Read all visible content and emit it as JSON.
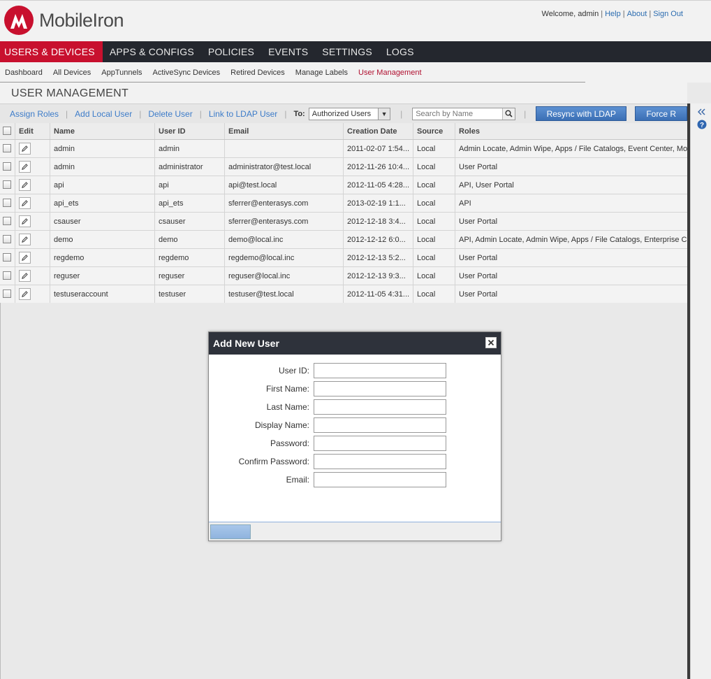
{
  "brand": {
    "name": "MobileIron",
    "accent": "#c8102e"
  },
  "top_links": {
    "welcome": "Welcome, admin",
    "help": "Help",
    "about": "About",
    "sign_out": "Sign Out"
  },
  "main_nav": [
    {
      "label": "USERS & DEVICES",
      "active": true
    },
    {
      "label": "APPS & CONFIGS"
    },
    {
      "label": "POLICIES"
    },
    {
      "label": "EVENTS"
    },
    {
      "label": "SETTINGS"
    },
    {
      "label": "LOGS"
    }
  ],
  "sub_nav": [
    {
      "label": "Dashboard"
    },
    {
      "label": "All Devices"
    },
    {
      "label": "AppTunnels"
    },
    {
      "label": "ActiveSync Devices"
    },
    {
      "label": "Retired Devices"
    },
    {
      "label": "Manage Labels"
    },
    {
      "label": "User Management",
      "active": true
    }
  ],
  "page_title": "USER MANAGEMENT",
  "toolbar": {
    "assign_roles": "Assign Roles",
    "add_local_user": "Add Local User",
    "delete_user": "Delete User",
    "link_ldap": "Link to LDAP User",
    "to_label": "To:",
    "to_select": "Authorized Users",
    "search_placeholder": "Search by Name",
    "resync": "Resync with LDAP",
    "force": "Force R"
  },
  "table": {
    "headers": {
      "edit": "Edit",
      "name": "Name",
      "user_id": "User ID",
      "email": "Email",
      "creation_date": "Creation Date",
      "source": "Source",
      "roles": "Roles"
    },
    "rows": [
      {
        "name": "admin",
        "user_id": "admin",
        "email": "",
        "date": "2011-02-07 1:54...",
        "source": "Local",
        "roles": "Admin Locate, Admin Wipe, Apps / File Catalogs, Event Center, Mobi"
      },
      {
        "name": "admin",
        "user_id": "administrator",
        "email": "administrator@test.local",
        "date": "2012-11-26 10:4...",
        "source": "Local",
        "roles": "User Portal"
      },
      {
        "name": "api",
        "user_id": "api",
        "email": "api@test.local",
        "date": "2012-11-05 4:28...",
        "source": "Local",
        "roles": "API, User Portal"
      },
      {
        "name": "api_ets",
        "user_id": "api_ets",
        "email": "sferrer@enterasys.com",
        "date": "2013-02-19 1:1...",
        "source": "Local",
        "roles": "API"
      },
      {
        "name": "csauser",
        "user_id": "csauser",
        "email": "sferrer@enterasys.com",
        "date": "2012-12-18 3:4...",
        "source": "Local",
        "roles": "User Portal"
      },
      {
        "name": "demo",
        "user_id": "demo",
        "email": "demo@local.inc",
        "date": "2012-12-12 6:0...",
        "source": "Local",
        "roles": "API, Admin Locate, Admin Wipe, Apps / File Catalogs, Enterprise Cor"
      },
      {
        "name": "regdemo",
        "user_id": "regdemo",
        "email": "regdemo@local.inc",
        "date": "2012-12-13 5:2...",
        "source": "Local",
        "roles": "User Portal"
      },
      {
        "name": "reguser",
        "user_id": "reguser",
        "email": "reguser@local.inc",
        "date": "2012-12-13 9:3...",
        "source": "Local",
        "roles": "User Portal"
      },
      {
        "name": "testuseraccount",
        "user_id": "testuser",
        "email": "testuser@test.local",
        "date": "2012-11-05 4:31...",
        "source": "Local",
        "roles": "User Portal"
      }
    ]
  },
  "modal": {
    "title": "Add New User",
    "fields": [
      {
        "label": "User ID:",
        "value": ""
      },
      {
        "label": "First Name:",
        "value": ""
      },
      {
        "label": "Last Name:",
        "value": ""
      },
      {
        "label": "Display Name:",
        "value": ""
      },
      {
        "label": "Password:",
        "value": ""
      },
      {
        "label": "Confirm Password:",
        "value": ""
      },
      {
        "label": "Email:",
        "value": ""
      }
    ]
  }
}
